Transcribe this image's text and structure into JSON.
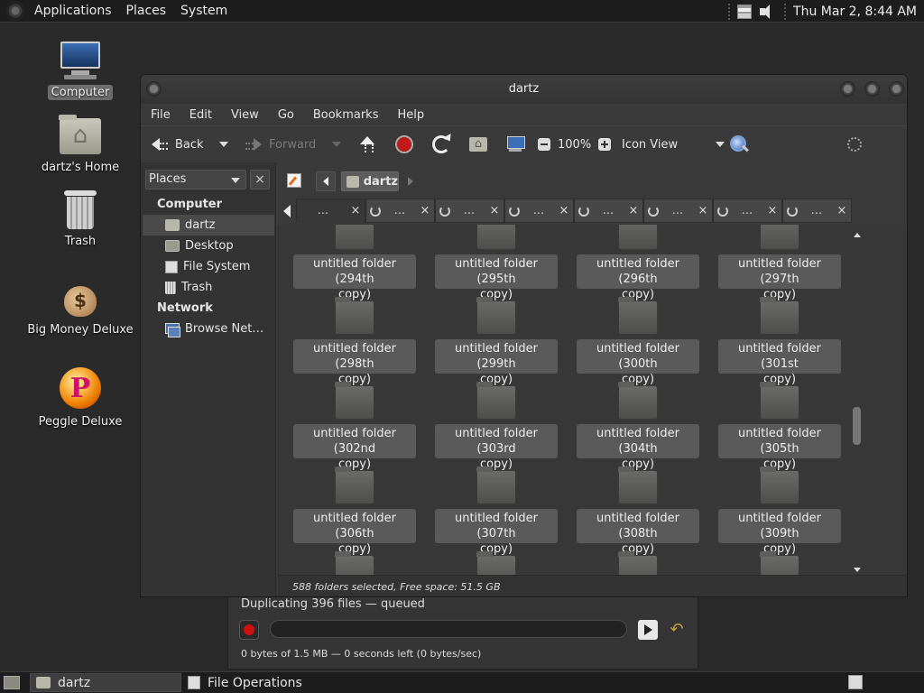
{
  "top_panel": {
    "menus": [
      "Applications",
      "Places",
      "System"
    ],
    "clock": "Thu Mar 2,  8:44 AM"
  },
  "desktop_icons": [
    {
      "label": "Computer",
      "icon": "computer-icon",
      "selected": true
    },
    {
      "label": "dartz's Home",
      "icon": "home-folder-icon"
    },
    {
      "label": "Trash",
      "icon": "trash-icon"
    },
    {
      "label": "Big Money Deluxe",
      "icon": "money-bag-icon"
    },
    {
      "label": "Peggle Deluxe",
      "icon": "peggle-icon"
    }
  ],
  "window": {
    "title": "dartz",
    "menus": [
      "File",
      "Edit",
      "View",
      "Go",
      "Bookmarks",
      "Help"
    ],
    "toolbar": {
      "back": "Back",
      "forward": "Forward",
      "zoom": "100%",
      "view_mode": "Icon View"
    },
    "sidepane": {
      "combo": "Places",
      "close": "×",
      "sections": [
        {
          "heading": "Computer",
          "items": [
            {
              "label": "dartz",
              "icon": "home-icon",
              "selected": true
            },
            {
              "label": "Desktop",
              "icon": "desktop-icon"
            },
            {
              "label": "File System",
              "icon": "filesystem-icon"
            },
            {
              "label": "Trash",
              "icon": "trash-icon"
            }
          ]
        },
        {
          "heading": "Network",
          "items": [
            {
              "label": "Browse Net…",
              "icon": "network-icon"
            }
          ]
        }
      ]
    },
    "location": {
      "crumb": "dartz"
    },
    "tabs": {
      "count": 8,
      "label": "...",
      "close": "×"
    },
    "folders": [
      "untitled folder (294th copy)",
      "untitled folder (295th copy)",
      "untitled folder (296th copy)",
      "untitled folder (297th copy)",
      "untitled folder (298th copy)",
      "untitled folder (299th copy)",
      "untitled folder (300th copy)",
      "untitled folder (301st copy)",
      "untitled folder (302nd copy)",
      "untitled folder (303rd copy)",
      "untitled folder (304th copy)",
      "untitled folder (305th copy)",
      "untitled folder (306th copy)",
      "untitled folder (307th copy)",
      "untitled folder (308th copy)",
      "untitled folder (309th copy)"
    ],
    "folder_lines": [
      [
        "untitled folder (294th",
        "copy)"
      ],
      [
        "untitled folder (295th",
        "copy)"
      ],
      [
        "untitled folder (296th",
        "copy)"
      ],
      [
        "untitled folder (297th",
        "copy)"
      ],
      [
        "untitled folder (298th",
        "copy)"
      ],
      [
        "untitled folder (299th",
        "copy)"
      ],
      [
        "untitled folder (300th",
        "copy)"
      ],
      [
        "untitled folder (301st",
        "copy)"
      ],
      [
        "untitled folder (302nd",
        "copy)"
      ],
      [
        "untitled folder (303rd",
        "copy)"
      ],
      [
        "untitled folder (304th",
        "copy)"
      ],
      [
        "untitled folder (305th",
        "copy)"
      ],
      [
        "untitled folder (306th",
        "copy)"
      ],
      [
        "untitled folder (307th",
        "copy)"
      ],
      [
        "untitled folder (308th",
        "copy)"
      ],
      [
        "untitled folder (309th",
        "copy)"
      ]
    ],
    "status": "588 folders selected, Free space: 51.5 GB"
  },
  "file_operations": {
    "status": "Duplicating 396 files — queued",
    "bytes": "0 bytes of 1.5 MB — 0 seconds left (0 bytes/sec)",
    "progress": 0
  },
  "bottom_panel": {
    "tasks": [
      "dartz",
      "File Operations"
    ]
  },
  "colors": {
    "panel_bg": "#1d1d1d",
    "window_bg": "#3a3a3a",
    "stop_red": "#d01010"
  }
}
